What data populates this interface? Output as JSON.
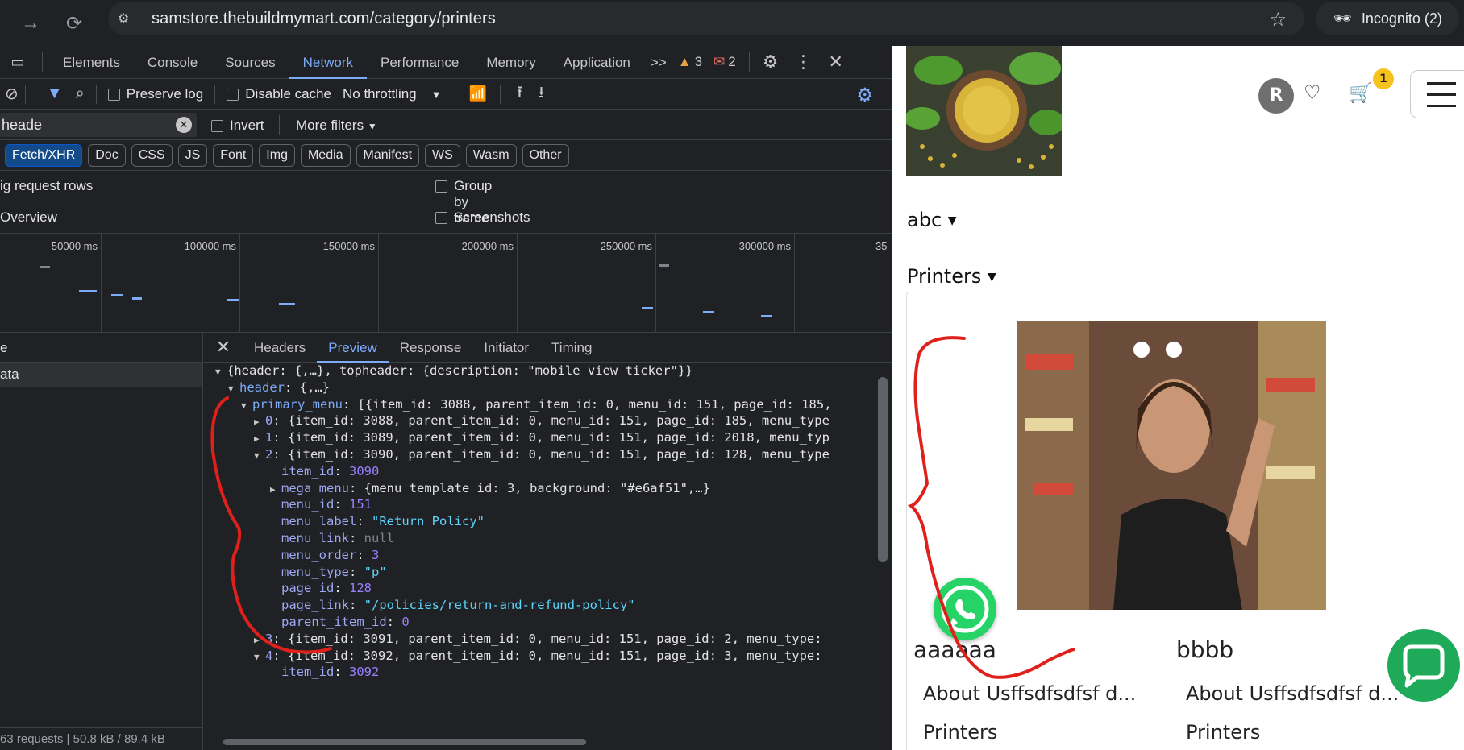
{
  "browser": {
    "url": "samstore.thebuildmymart.com/category/printers",
    "incognito_label": "Incognito (2)"
  },
  "devtools": {
    "tabs": [
      "Elements",
      "Console",
      "Sources",
      "Network",
      "Performance",
      "Memory",
      "Application"
    ],
    "active_tab": "Network",
    "more_tabs": ">>",
    "warnings": "3",
    "errors": "2",
    "toolbar": {
      "preserve_log": "Preserve log",
      "disable_cache": "Disable cache",
      "throttling": "No throttling"
    },
    "filter": {
      "value": "heade",
      "invert": "Invert",
      "more_filters": "More filters"
    },
    "type_filters": [
      "Fetch/XHR",
      "Doc",
      "CSS",
      "JS",
      "Font",
      "Img",
      "Media",
      "Manifest",
      "WS",
      "Wasm",
      "Other"
    ],
    "active_type": "Fetch/XHR",
    "options": {
      "big_rows": "ig request rows",
      "group_by_frame": "Group by frame",
      "overview": "Overview",
      "screenshots": "Screenshots"
    },
    "timeline_labels": [
      "50000 ms",
      "100000 ms",
      "150000 ms",
      "200000 ms",
      "250000 ms",
      "300000 ms",
      "35"
    ],
    "request_list": {
      "header": "e",
      "selected": "ata",
      "footer": "63 requests  |  50.8 kB / 89.4 kB"
    },
    "detail_tabs": [
      "Headers",
      "Preview",
      "Response",
      "Initiator",
      "Timing"
    ],
    "active_detail": "Preview",
    "preview": [
      {
        "indent": 0,
        "toggle": "▼",
        "text": "{header: {,…}, topheader: {description: \"mobile view ticker\"}}"
      },
      {
        "indent": 1,
        "toggle": "▼",
        "key": "header",
        "text": ": {,…}"
      },
      {
        "indent": 2,
        "toggle": "▼",
        "key": "primary_menu",
        "text": ": [{item_id: 3088, parent_item_id: 0, menu_id: 151, page_id: 185,"
      },
      {
        "indent": 3,
        "toggle": "▶",
        "key": "0",
        "text": ": {item_id: 3088, parent_item_id: 0, menu_id: 151, page_id: 185, menu_type"
      },
      {
        "indent": 3,
        "toggle": "▶",
        "key": "1",
        "text": ": {item_id: 3089, parent_item_id: 0, menu_id: 151, page_id: 2018, menu_typ"
      },
      {
        "indent": 3,
        "toggle": "▼",
        "key": "2",
        "text": ": {item_id: 3090, parent_item_id: 0, menu_id: 151, page_id: 128, menu_type"
      },
      {
        "indent": 4,
        "toggle": "",
        "key": "item_id",
        "value": "3090",
        "vtype": "num"
      },
      {
        "indent": 4,
        "toggle": "▶",
        "key": "mega_menu",
        "text": ": {menu_template_id: 3, background: \"#e6af51\",…}"
      },
      {
        "indent": 4,
        "toggle": "",
        "key": "menu_id",
        "value": "151",
        "vtype": "num"
      },
      {
        "indent": 4,
        "toggle": "",
        "key": "menu_label",
        "value": "\"Return Policy\"",
        "vtype": "str"
      },
      {
        "indent": 4,
        "toggle": "",
        "key": "menu_link",
        "value": "null",
        "vtype": "nul"
      },
      {
        "indent": 4,
        "toggle": "",
        "key": "menu_order",
        "value": "3",
        "vtype": "num"
      },
      {
        "indent": 4,
        "toggle": "",
        "key": "menu_type",
        "value": "\"p\"",
        "vtype": "str"
      },
      {
        "indent": 4,
        "toggle": "",
        "key": "page_id",
        "value": "128",
        "vtype": "num"
      },
      {
        "indent": 4,
        "toggle": "",
        "key": "page_link",
        "value": "\"/policies/return-and-refund-policy\"",
        "vtype": "str"
      },
      {
        "indent": 4,
        "toggle": "",
        "key": "parent_item_id",
        "value": "0",
        "vtype": "num"
      },
      {
        "indent": 3,
        "toggle": "▶",
        "key": "3",
        "text": ": {item_id: 3091, parent_item_id: 0, menu_id: 151, page_id: 2, menu_type:"
      },
      {
        "indent": 3,
        "toggle": "▼",
        "key": "4",
        "text": ": {item_id: 3092, parent_item_id: 0, menu_id: 151, page_id: 3, menu_type:"
      },
      {
        "indent": 4,
        "toggle": "",
        "key": "item_id",
        "value": "3092",
        "vtype": "num"
      }
    ]
  },
  "page": {
    "avatar_letter": "R",
    "cart_count": "1",
    "nav_abc": "abc",
    "nav_printers": "Printers",
    "products": [
      {
        "title": "aaaaaa",
        "link1": "About Usffsdfsdfsf d...",
        "link2": "Printers"
      },
      {
        "title": "bbbb",
        "link1": "About Usffsdfsdfsf d...",
        "link2": "Printers"
      }
    ]
  },
  "colors": {
    "accent": "#7cacf8",
    "annotation": "#e0201b",
    "whatsapp": "#25d366",
    "cart_badge": "#f7c21d"
  }
}
